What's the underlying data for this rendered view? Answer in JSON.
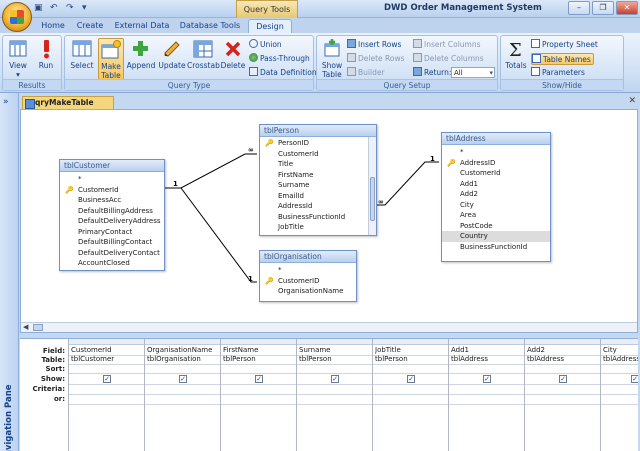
{
  "titlebar": {
    "context_tab": "Query Tools",
    "app_title": "DWD Order Management System",
    "window_buttons": [
      "–",
      "❐",
      "✕"
    ]
  },
  "ribbon_tabs": [
    {
      "label": "Home",
      "active": false
    },
    {
      "label": "Create",
      "active": false
    },
    {
      "label": "External Data",
      "active": false
    },
    {
      "label": "Database Tools",
      "active": false
    },
    {
      "label": "Design",
      "active": true
    }
  ],
  "ribbon": {
    "results": {
      "label": "Results",
      "view": "View",
      "run": "Run"
    },
    "query_type": {
      "label": "Query Type",
      "select": "Select",
      "make_table": "Make Table",
      "append": "Append",
      "update": "Update",
      "crosstab": "Crosstab",
      "delete": "Delete",
      "union": "Union",
      "pass_through": "Pass-Through",
      "data_definition": "Data Definition"
    },
    "query_setup": {
      "label": "Query Setup",
      "show_table": "Show Table",
      "insert_rows": "Insert Rows",
      "delete_rows": "Delete Rows",
      "builder": "Builder",
      "insert_columns": "Insert Columns",
      "delete_columns": "Delete Columns",
      "return_label": "Return:",
      "return_value": "All"
    },
    "show_hide": {
      "label": "Show/Hide",
      "totals": "Totals",
      "property_sheet": "Property Sheet",
      "table_names": "Table Names",
      "parameters": "Parameters"
    }
  },
  "nav_pane": {
    "label": "Navigation Pane",
    "collapse": "»"
  },
  "document": {
    "tab": "qryMakeTable",
    "close": "✕"
  },
  "tables": {
    "tblCustomer": {
      "title": "tblCustomer",
      "fields": [
        "*",
        "CustomerId",
        "BusinessAcc",
        "DefaultBillingAddress",
        "DefaultDeliveryAddress",
        "PrimaryContact",
        "DefaultBillingContact",
        "DefaultDeliveryContact",
        "AccountClosed"
      ]
    },
    "tblPerson": {
      "title": "tblPerson",
      "fields": [
        "PersonID",
        "CustomerId",
        "Title",
        "FirstName",
        "Surname",
        "EmailId",
        "AddressId",
        "BusinessFunctionId",
        "JobTitle"
      ]
    },
    "tblOrganisation": {
      "title": "tblOrganisation",
      "fields": [
        "*",
        "CustomerID",
        "OrganisationName"
      ]
    },
    "tblAddress": {
      "title": "tblAddress",
      "fields": [
        "*",
        "AddressID",
        "CustomerId",
        "Add1",
        "Add2",
        "City",
        "Area",
        "PostCode",
        "Country",
        "BusinessFunctionId"
      ]
    }
  },
  "joins": {
    "one": "1",
    "many": "∞"
  },
  "grid": {
    "row_labels": [
      "Field:",
      "Table:",
      "Sort:",
      "Show:",
      "Criteria:",
      "or:"
    ],
    "columns": [
      {
        "field": "CustomerId",
        "table": "tblCustomer",
        "show": true
      },
      {
        "field": "OrganisationName",
        "table": "tblOrganisation",
        "show": true
      },
      {
        "field": "FirstName",
        "table": "tblPerson",
        "show": true
      },
      {
        "field": "Surname",
        "table": "tblPerson",
        "show": true
      },
      {
        "field": "JobTitle",
        "table": "tblPerson",
        "show": true
      },
      {
        "field": "Add1",
        "table": "tblAddress",
        "show": true
      },
      {
        "field": "Add2",
        "table": "tblAddress",
        "show": true
      },
      {
        "field": "City",
        "table": "tblAddress",
        "show": true
      }
    ],
    "check_mark": "✓"
  },
  "colors": {
    "accent": "#15428b",
    "pressed": "#f8c860",
    "title_gradient": "#b8d0ef"
  }
}
